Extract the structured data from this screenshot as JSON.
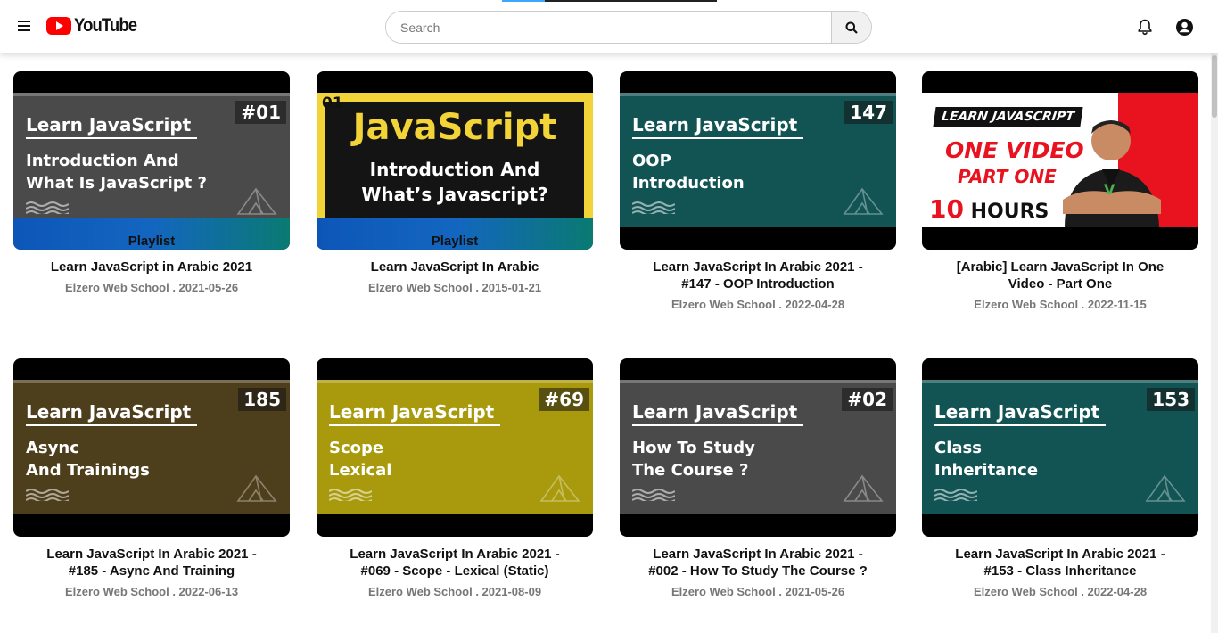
{
  "header": {
    "logo_text": "YouTube",
    "search_placeholder": "Search",
    "icons": [
      "menu-icon",
      "search-icon",
      "bell-icon",
      "account-icon"
    ],
    "brand_color": "#ff0000"
  },
  "videos": [
    {
      "title": "Learn JavaScript in Arabic 2021",
      "meta": "Elzero Web School . 2021-05-26",
      "thumb": {
        "style": "panel",
        "bg": "#4a4a4a",
        "heading": "Learn JavaScript",
        "sub": "Introduction And\nWhat Is JavaScript ?",
        "number": "#01",
        "playlist": "Playlist"
      }
    },
    {
      "title": "Learn JavaScript In Arabic",
      "meta": "Elzero Web School . 2015-01-21",
      "thumb": {
        "style": "js-yellow",
        "num": "01",
        "big": "JavaScript",
        "small": "Introduction And\nWhat’s Javascript?",
        "playlist": "Playlist"
      }
    },
    {
      "title": "Learn JavaScript In Arabic 2021 - #147 - OOP Introduction",
      "meta": "Elzero Web School . 2022-04-28",
      "thumb": {
        "style": "panel",
        "bg": "#125454",
        "heading": "Learn JavaScript",
        "sub": "OOP\nIntroduction",
        "number": "147"
      }
    },
    {
      "title": "[Arabic] Learn JavaScript In One Video - Part One",
      "meta": "Elzero Web School . 2022-11-15",
      "thumb": {
        "style": "one-video",
        "tag": "LEARN JAVASCRIPT",
        "line1": "ONE VIDEO",
        "line2": "PART ONE",
        "hours_num": "10",
        "hours": "HOURS"
      }
    },
    {
      "title": "Learn JavaScript In Arabic 2021 - #185 - Async And Training",
      "meta": "Elzero Web School . 2022-06-13",
      "thumb": {
        "style": "panel",
        "bg": "#4e3f1c",
        "heading": "Learn JavaScript",
        "sub": "Async\nAnd Trainings",
        "number": "185"
      }
    },
    {
      "title": "Learn JavaScript In Arabic 2021 - #069 - Scope - Lexical (Static)",
      "meta": "Elzero Web School . 2021-08-09",
      "thumb": {
        "style": "panel",
        "bg": "#a89a0c",
        "heading": "Learn JavaScript",
        "sub": "Scope\nLexical",
        "number": "#69"
      }
    },
    {
      "title": "Learn JavaScript In Arabic 2021 - #002 - How To Study The Course ?",
      "meta": "Elzero Web School . 2021-05-26",
      "thumb": {
        "style": "panel",
        "bg": "#4a4a4a",
        "heading": "Learn JavaScript",
        "sub": "How To Study\nThe Course ?",
        "number": "#02"
      }
    },
    {
      "title": "Learn JavaScript In Arabic 2021 - #153 - Class Inheritance",
      "meta": "Elzero Web School . 2022-04-28",
      "thumb": {
        "style": "panel",
        "bg": "#125454",
        "heading": "Learn JavaScript",
        "sub": "Class\nInheritance",
        "number": "153"
      }
    }
  ]
}
